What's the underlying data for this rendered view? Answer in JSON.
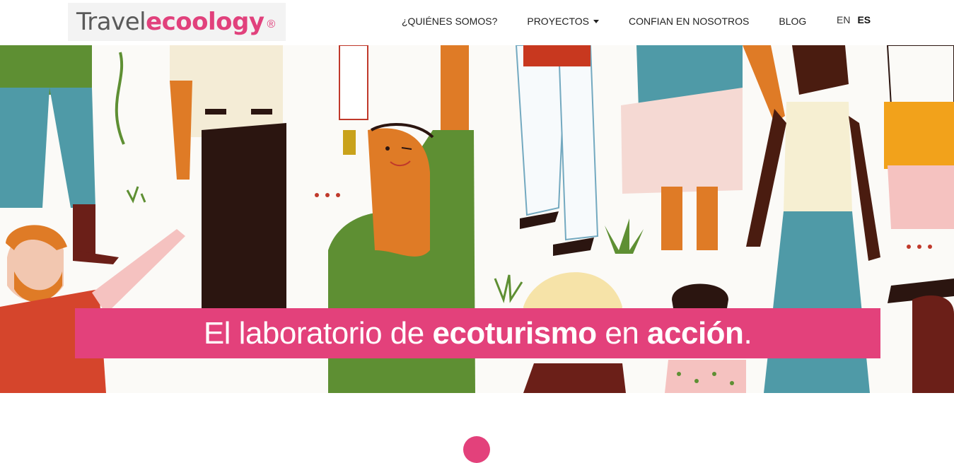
{
  "brand": {
    "part1": "Travel",
    "part2": "ecoology",
    "mark": "®"
  },
  "nav": {
    "items": [
      {
        "label": "¿QUIÉNES SOMOS?",
        "dropdown": false
      },
      {
        "label": "PROYECTOS",
        "dropdown": true
      },
      {
        "label": "CONFIAN EN NOSOTROS",
        "dropdown": false
      },
      {
        "label": "BLOG",
        "dropdown": false
      }
    ]
  },
  "languages": {
    "en": "EN",
    "es": "ES",
    "active": "ES"
  },
  "hero": {
    "headline": {
      "t1": "El laboratorio de ",
      "b1": "ecoturismo",
      "t2": " en ",
      "b2": "acción",
      "t3": "."
    }
  },
  "colors": {
    "accent": "#e3417b",
    "text": "#222222",
    "logo_gray": "#5a5a5a"
  }
}
